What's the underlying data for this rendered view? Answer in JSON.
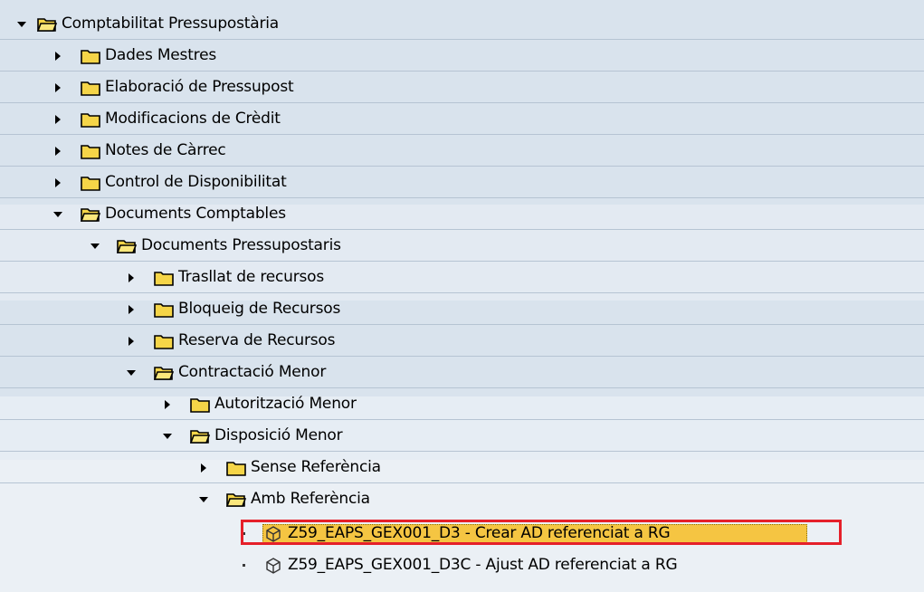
{
  "colors": {
    "band_blue": "#d9e3ed",
    "band_light": "#ebf0f5",
    "selection_fill": "#f5c542",
    "selection_border": "#e5202a",
    "folder": "#f5d548"
  },
  "tree": {
    "nodes": [
      {
        "label": "Comptabilitat Pressupostària",
        "state": "expanded",
        "icon": "folder-open-icon"
      },
      {
        "label": "Dades Mestres",
        "state": "collapsed",
        "icon": "folder-icon"
      },
      {
        "label": "Elaboració de Pressupost",
        "state": "collapsed",
        "icon": "folder-icon"
      },
      {
        "label": "Modificacions de Crèdit",
        "state": "collapsed",
        "icon": "folder-icon"
      },
      {
        "label": "Notes de Càrrec",
        "state": "collapsed",
        "icon": "folder-icon"
      },
      {
        "label": "Control de Disponibilitat",
        "state": "collapsed",
        "icon": "folder-icon"
      },
      {
        "label": "Documents Comptables",
        "state": "expanded",
        "icon": "folder-open-icon"
      },
      {
        "label": "Documents Pressupostaris",
        "state": "expanded",
        "icon": "folder-open-icon"
      },
      {
        "label": "Trasllat de recursos",
        "state": "collapsed",
        "icon": "folder-icon"
      },
      {
        "label": "Bloqueig de Recursos",
        "state": "collapsed",
        "icon": "folder-icon"
      },
      {
        "label": "Reserva de Recursos",
        "state": "collapsed",
        "icon": "folder-icon"
      },
      {
        "label": "Contractació Menor",
        "state": "expanded",
        "icon": "folder-open-icon"
      },
      {
        "label": "Autorització Menor",
        "state": "collapsed",
        "icon": "folder-icon"
      },
      {
        "label": "Disposició Menor",
        "state": "expanded",
        "icon": "folder-open-icon"
      },
      {
        "label": "Sense Referència",
        "state": "collapsed",
        "icon": "folder-icon"
      },
      {
        "label": "Amb Referència",
        "state": "expanded",
        "icon": "folder-open-icon"
      },
      {
        "label": "Z59_EAPS_GEX001_D3 - Crear AD referenciat a RG",
        "state": "leaf",
        "icon": "transaction-cube-icon",
        "selected": true
      },
      {
        "label": "Z59_EAPS_GEX001_D3C - Ajust AD referenciat a RG",
        "state": "leaf",
        "icon": "transaction-cube-icon"
      }
    ]
  }
}
